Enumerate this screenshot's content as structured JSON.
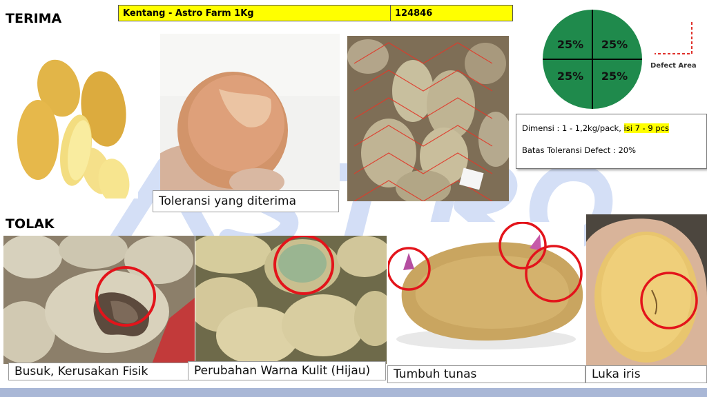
{
  "header": {
    "accept_label": "TERIMA",
    "reject_label": "TOLAK",
    "product_name": "Kentang - Astro Farm 1Kg",
    "product_code": "124846"
  },
  "defect_diagram": {
    "quadrants": [
      "25%",
      "25%",
      "25%",
      "25%"
    ],
    "legend_label": "Defect Area",
    "circle_color": "#1f8a4c",
    "legend_color": "#e0302a"
  },
  "specs": {
    "dimension_prefix": "Dimensi : 1 - 1,2kg/pack, ",
    "dimension_highlight": "isi 7 - 9 pcs",
    "tolerance": "Batas Toleransi Defect : 20%"
  },
  "accept_photos": {
    "tolerance_caption": "Toleransi yang diterima"
  },
  "reject_photos": [
    {
      "caption": "Busuk, Kerusakan Fisik"
    },
    {
      "caption": "Perubahan Warna Kulit (Hijau)"
    },
    {
      "caption": "Tumbuh tunas"
    },
    {
      "caption": "Luka iris"
    }
  ],
  "colors": {
    "highlight": "#ffff00",
    "marker_circle": "#e3141b",
    "watermark": "#3a6fd8",
    "bottom_band": "#a9b7d6"
  }
}
